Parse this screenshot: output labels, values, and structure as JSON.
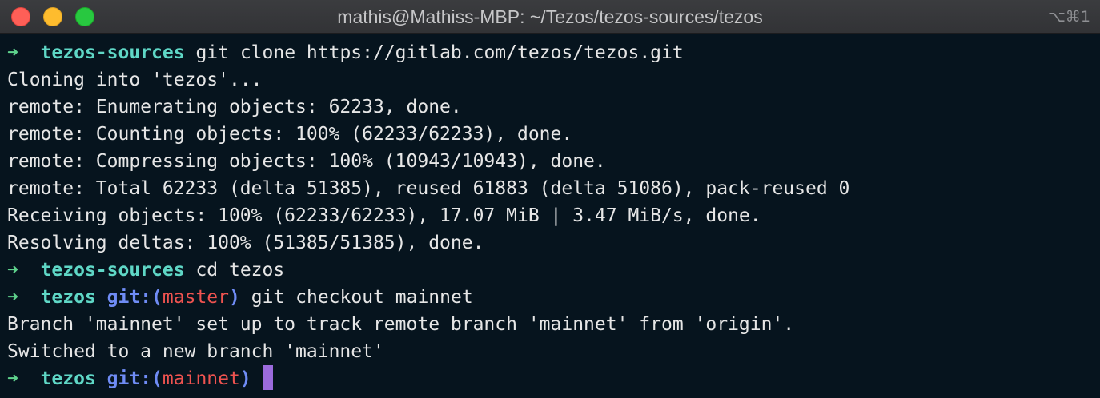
{
  "window": {
    "title": "mathis@Mathiss-MBP: ~/Tezos/tezos-sources/tezos",
    "shortcut": "⌥⌘1",
    "buttons": {
      "close_color": "#fe5f57",
      "minimize_color": "#febc2e",
      "zoom_color": "#28c840"
    }
  },
  "terminal": {
    "background": "#06141e",
    "prompt_arrow": "➜",
    "lines": {
      "l0": {
        "dir": "tezos-sources",
        "command": "git clone https://gitlab.com/tezos/tezos.git"
      },
      "l1": "Cloning into 'tezos'...",
      "l2": "remote: Enumerating objects: 62233, done.",
      "l3": "remote: Counting objects: 100% (62233/62233), done.",
      "l4": "remote: Compressing objects: 100% (10943/10943), done.",
      "l5": "remote: Total 62233 (delta 51385), reused 61883 (delta 51086), pack-reused 0",
      "l6": "Receiving objects: 100% (62233/62233), 17.07 MiB | 3.47 MiB/s, done.",
      "l7": "Resolving deltas: 100% (51385/51385), done.",
      "l8": {
        "dir": "tezos-sources",
        "command": "cd tezos"
      },
      "l9": {
        "dir": "tezos",
        "git_open": "git:(",
        "branch": "master",
        "git_close": ")",
        "command": "git checkout mainnet"
      },
      "l10": "Branch 'mainnet' set up to track remote branch 'mainnet' from 'origin'.",
      "l11": "Switched to a new branch 'mainnet'",
      "l12": {
        "dir": "tezos",
        "git_open": "git:(",
        "branch": "mainnet",
        "git_close": ")"
      }
    }
  }
}
